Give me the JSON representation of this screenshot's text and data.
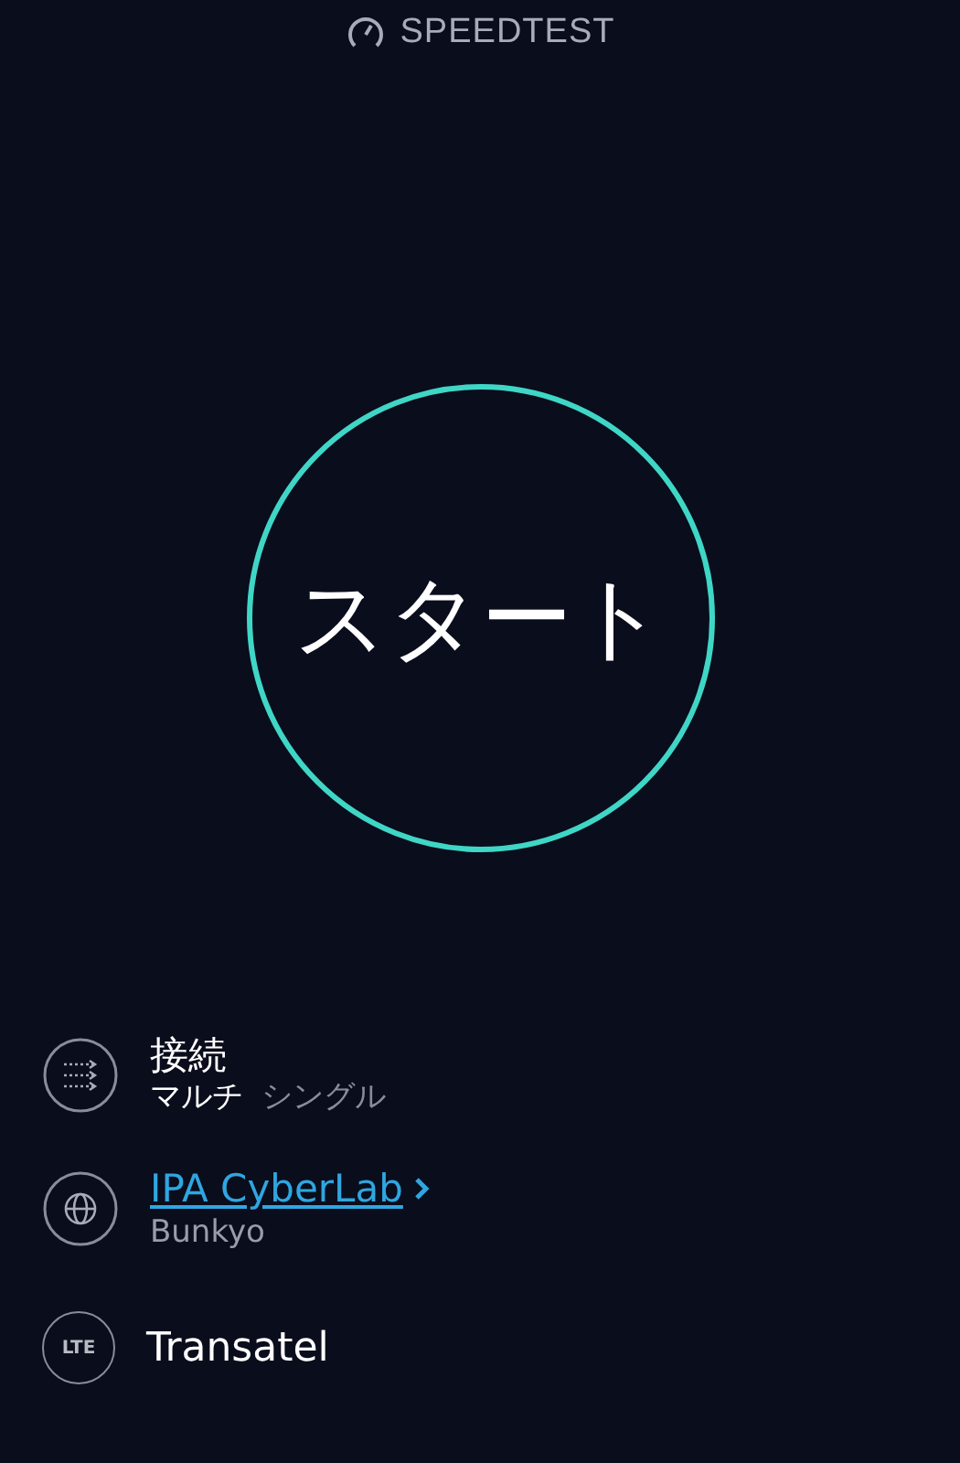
{
  "header": {
    "title": "SPEEDTEST"
  },
  "start_button": {
    "label": "スタート"
  },
  "connection": {
    "title": "接続",
    "options": [
      {
        "label": "マルチ",
        "selected": true
      },
      {
        "label": "シングル",
        "selected": false
      }
    ]
  },
  "server": {
    "name": "IPA CyberLab",
    "location": "Bunkyo"
  },
  "provider": {
    "badge": "LTE",
    "name": "Transatel"
  }
}
